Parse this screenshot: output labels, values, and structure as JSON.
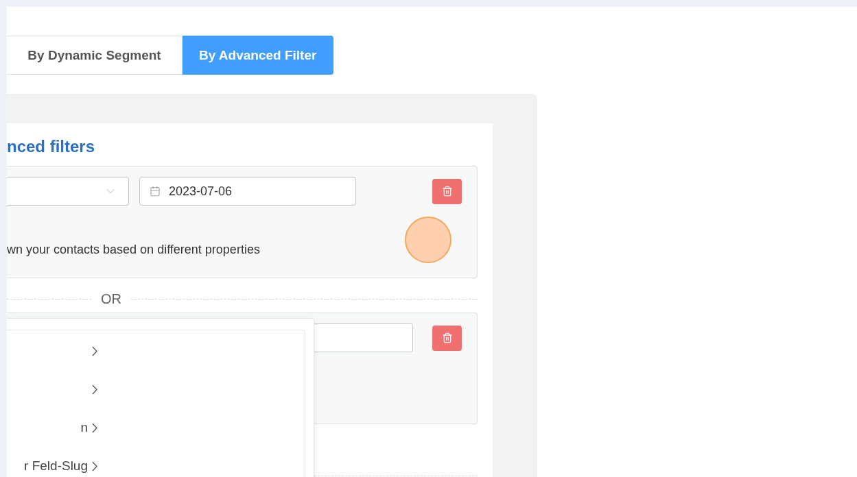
{
  "tabs": [
    {
      "label": "By Dynamic Segment",
      "selected": false
    },
    {
      "label": "By Advanced Filter",
      "selected": true
    }
  ],
  "card": {
    "title": "nced filters",
    "groups": [
      {
        "select": {
          "kind": "select"
        },
        "date": {
          "value": "2023-07-06"
        },
        "hint": "wn your contacts based on different properties"
      },
      {
        "input": {
          "kind": "text"
        }
      }
    ],
    "divider": "OR"
  },
  "menu": {
    "items": [
      {
        "has_submenu": true
      },
      {
        "has_submenu": true
      },
      {
        "label": "n",
        "has_submenu": true
      },
      {
        "label": "r Feld-Slug",
        "has_submenu": true
      }
    ]
  }
}
